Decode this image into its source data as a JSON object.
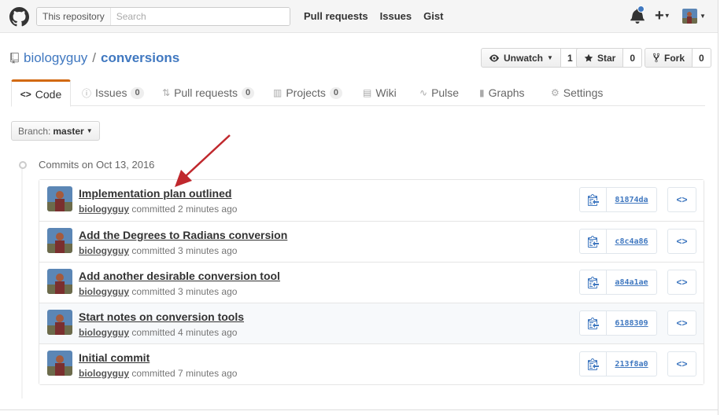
{
  "header": {
    "scope_label": "This repository",
    "search_placeholder": "Search",
    "nav": [
      "Pull requests",
      "Issues",
      "Gist"
    ],
    "accent": "#4078c0"
  },
  "repo": {
    "owner": "biologyguy",
    "separator": "/",
    "name": "conversions",
    "watch_label": "Unwatch",
    "watch_count": "1",
    "star_label": "Star",
    "star_count": "0",
    "fork_label": "Fork",
    "fork_count": "0"
  },
  "tabs": {
    "code": "Code",
    "issues": "Issues",
    "issues_count": "0",
    "pulls": "Pull requests",
    "pulls_count": "0",
    "projects": "Projects",
    "projects_count": "0",
    "wiki": "Wiki",
    "pulse": "Pulse",
    "graphs": "Graphs",
    "settings": "Settings",
    "selected_color": "#d26911"
  },
  "branch": {
    "label": "Branch:",
    "value": "master"
  },
  "commits": {
    "group_title": "Commits on Oct 13, 2016",
    "items": [
      {
        "title": "Implementation plan outlined",
        "author": "biologyguy",
        "verb": "committed",
        "when": "2 minutes ago",
        "sha": "81874da"
      },
      {
        "title": "Add the Degrees to Radians conversion",
        "author": "biologyguy",
        "verb": "committed",
        "when": "3 minutes ago",
        "sha": "c8c4a86"
      },
      {
        "title": "Add another desirable conversion tool",
        "author": "biologyguy",
        "verb": "committed",
        "when": "3 minutes ago",
        "sha": "a84a1ae"
      },
      {
        "title": "Start notes on conversion tools",
        "author": "biologyguy",
        "verb": "committed",
        "when": "4 minutes ago",
        "sha": "6188309"
      },
      {
        "title": "Initial commit",
        "author": "biologyguy",
        "verb": "committed",
        "when": "7 minutes ago",
        "sha": "213f8a0"
      }
    ],
    "browse_label": "<>"
  },
  "annotation": {
    "arrow_color": "#c0282d"
  }
}
